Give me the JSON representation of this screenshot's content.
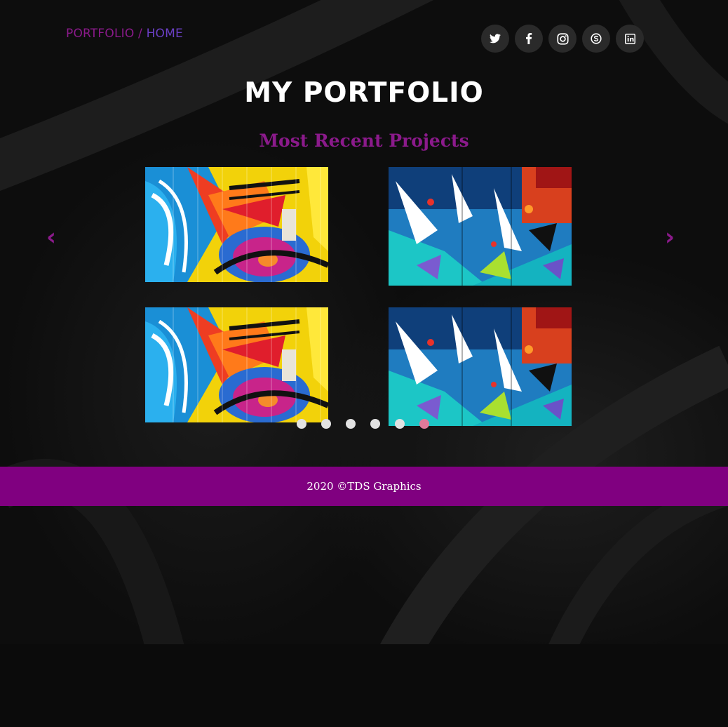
{
  "breadcrumb": {
    "first": "PORTFOLIO",
    "separator": " / ",
    "current": "HOME"
  },
  "social": [
    {
      "name": "twitter",
      "icon": "twitter-icon"
    },
    {
      "name": "facebook",
      "icon": "facebook-icon"
    },
    {
      "name": "instagram",
      "icon": "instagram-icon"
    },
    {
      "name": "skype",
      "icon": "skype-icon"
    },
    {
      "name": "linkedin",
      "icon": "linkedin-icon"
    }
  ],
  "hero": {
    "title": "MY PORTFOLIO",
    "subtitle": "Most Recent Projects"
  },
  "carousel": {
    "prev_label": "‹",
    "next_label": "›",
    "dot_count": 6,
    "active_dot": 6,
    "images": [
      "graffiti-yellow-artwork",
      "graffiti-blue-artwork",
      "graffiti-yellow-artwork",
      "graffiti-blue-artwork"
    ]
  },
  "footer": {
    "text": "2020 ©TDS Graphics"
  },
  "colors": {
    "accent": "#800080",
    "accent_text": "#8b1a8b",
    "home_link": "#6a3fc4",
    "background": "#0c0c0c",
    "dot": "#e2e2e2",
    "dot_active": "#e07a9a"
  }
}
